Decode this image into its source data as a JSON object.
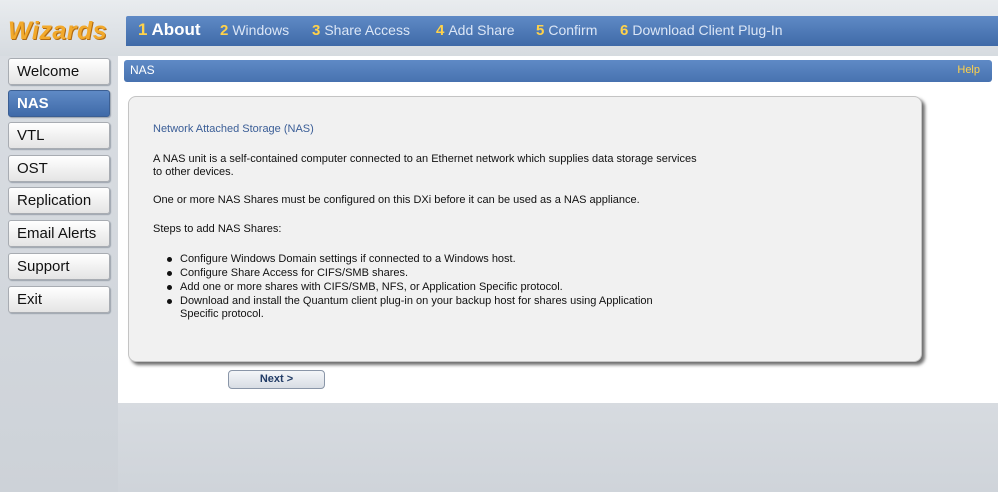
{
  "header": {
    "wizard_title": "Wizards",
    "steps": [
      {
        "num": "1",
        "label": "About"
      },
      {
        "num": "2",
        "label": "Windows"
      },
      {
        "num": "3",
        "label": "Share Access"
      },
      {
        "num": "4",
        "label": "Add Share"
      },
      {
        "num": "5",
        "label": "Confirm"
      },
      {
        "num": "6",
        "label": "Download Client Plug-In"
      }
    ]
  },
  "sidebar": {
    "items": [
      {
        "label": "Welcome"
      },
      {
        "label": "NAS"
      },
      {
        "label": "VTL"
      },
      {
        "label": "OST"
      },
      {
        "label": "Replication"
      },
      {
        "label": "Email Alerts"
      },
      {
        "label": "Support"
      },
      {
        "label": "Exit"
      }
    ]
  },
  "panel": {
    "title": "NAS",
    "help": "Help"
  },
  "card": {
    "heading": "Network Attached Storage (NAS)",
    "para1_line1": "A NAS unit is a self-contained computer connected to an Ethernet network which supplies data storage services",
    "para1_line2": "to other devices.",
    "para2": "One or more NAS Shares must be configured on this DXi before it can be used as a NAS appliance.",
    "steps_title": "Steps to add NAS Shares:",
    "bullets": [
      {
        "line1": "Configure Windows Domain settings if connected to a Windows host.",
        "line2": ""
      },
      {
        "line1": "Configure Share Access for CIFS/SMB shares.",
        "line2": ""
      },
      {
        "line1": "Add one or more shares with CIFS/SMB, NFS, or Application Specific protocol.",
        "line2": ""
      },
      {
        "line1": "Download and install the Quantum client plug-in on your backup host for shares using Application",
        "line2": "Specific protocol."
      }
    ]
  },
  "footer": {
    "next_label": "Next >"
  },
  "colors": {
    "accent_blue": "#4f7bb9",
    "step_number": "#ffd24a",
    "wizard_title": "#f2a92b"
  }
}
